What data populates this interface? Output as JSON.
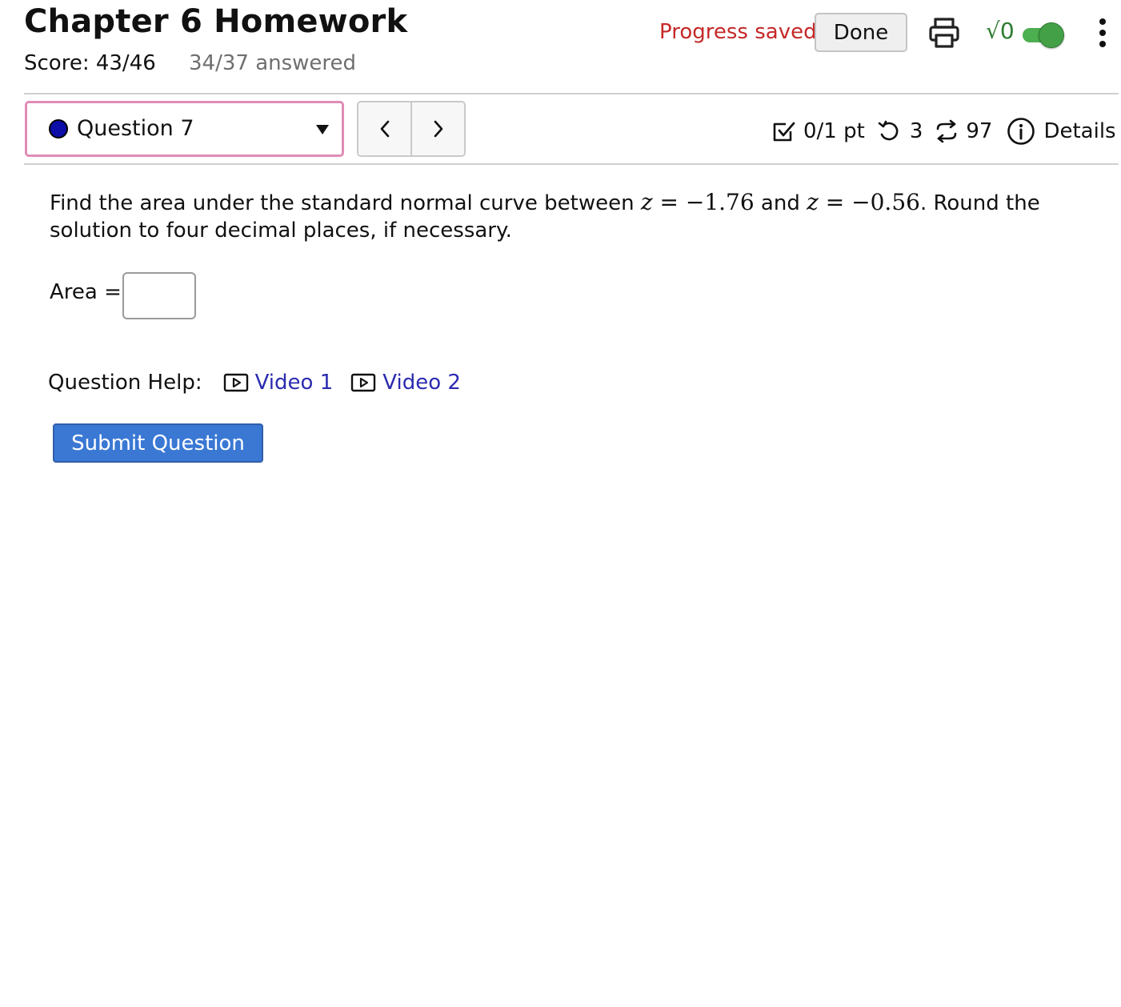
{
  "header": {
    "title": "Chapter 6 Homework",
    "score": "Score: 43/46",
    "answered": "34/37 answered",
    "progress_status": "Progress saved",
    "done_label": "Done",
    "math_toggle_label": "√0",
    "math_toggle_on": true
  },
  "question_nav": {
    "selected_question": "Question 7",
    "prev_symbol": "‹",
    "next_symbol": "›"
  },
  "question_info": {
    "points": "0/1 pt",
    "attempts": "3",
    "versions": "97",
    "details_label": "Details"
  },
  "question": {
    "prompt_before": "Find the area under the standard normal curve between ",
    "var": "z",
    "eq": " = ",
    "z1": "−1.76",
    "mid": " and ",
    "z2": "−0.56",
    "prompt_after": ". Round the solution to four decimal places, if necessary.",
    "answer_label": "Area =",
    "answer_value": ""
  },
  "help": {
    "label": "Question Help:",
    "videos": [
      "Video 1",
      "Video 2"
    ]
  },
  "submit_label": "Submit Question",
  "colors": {
    "progress_text": "#c62828",
    "select_border": "#e08cb5",
    "link": "#2b2bb0",
    "submit_bg": "#3a78d4",
    "toggle_on": "#43a047"
  }
}
